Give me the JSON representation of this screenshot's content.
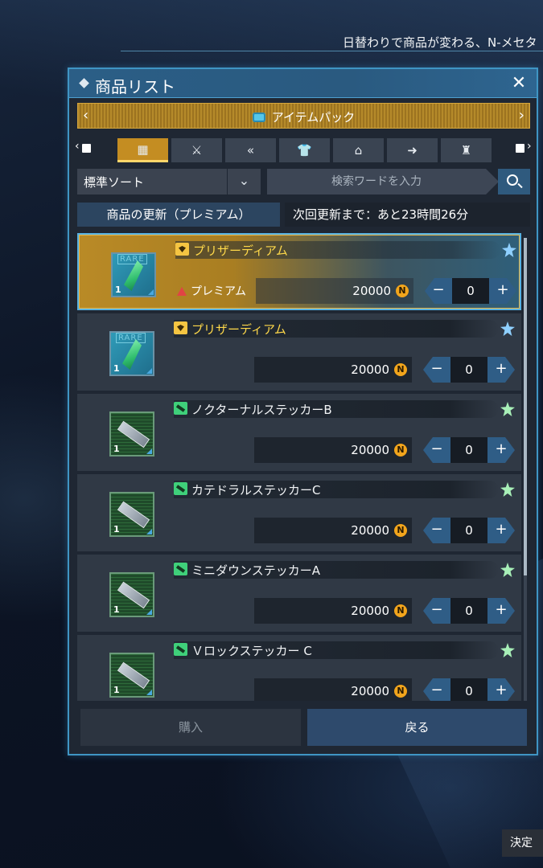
{
  "ticker": "日替わりで商品が変わる、N-メセタ",
  "window": {
    "title": "商品リスト",
    "close_symbol": "✕"
  },
  "category": {
    "label": "アイテムパック",
    "left_arrow": "‹",
    "right_arrow": "›"
  },
  "filter_tabs": [
    {
      "name": "all",
      "icon": "▦",
      "active": true
    },
    {
      "name": "weapon",
      "icon": "⚔",
      "active": false
    },
    {
      "name": "motion",
      "icon": "«",
      "active": false
    },
    {
      "name": "costume",
      "icon": "👕",
      "active": false
    },
    {
      "name": "tag",
      "icon": "⌂",
      "active": false
    },
    {
      "name": "arrow-sign",
      "icon": "➜",
      "active": false
    },
    {
      "name": "bag",
      "icon": "♜",
      "active": false
    }
  ],
  "sort": {
    "label": "標準ソート",
    "dropdown_symbol": "⌄"
  },
  "search": {
    "placeholder": "検索ワードを入力"
  },
  "refresh": {
    "label": "商品の更新（プレミアム）",
    "timer": "次回更新まで：あと23時間26分"
  },
  "items": [
    {
      "name": "プリザーディアム",
      "type": "gem",
      "name_color": "gold",
      "thumb": "rare",
      "thumb_tag": "RARE",
      "thumb_qty": "1",
      "premium": true,
      "premium_label": "プレミアム",
      "price": "20000",
      "currency_symbol": "N",
      "qty": "0",
      "selected": true,
      "minus": "−",
      "plus": "+"
    },
    {
      "name": "プリザーディアム",
      "type": "gem",
      "name_color": "gold",
      "thumb": "rare",
      "thumb_tag": "RARE",
      "thumb_qty": "1",
      "premium": false,
      "premium_label": "",
      "price": "20000",
      "currency_symbol": "N",
      "qty": "0",
      "selected": false,
      "minus": "−",
      "plus": "+"
    },
    {
      "name": "ノクターナルステッカーB",
      "type": "sticker",
      "name_color": "white",
      "thumb": "sticker",
      "thumb_tag": "",
      "thumb_qty": "1",
      "premium": false,
      "premium_label": "",
      "price": "20000",
      "currency_symbol": "N",
      "qty": "0",
      "selected": false,
      "minus": "−",
      "plus": "+"
    },
    {
      "name": "カテドラルステッカーC",
      "type": "sticker",
      "name_color": "white",
      "thumb": "sticker",
      "thumb_tag": "",
      "thumb_qty": "1",
      "premium": false,
      "premium_label": "",
      "price": "20000",
      "currency_symbol": "N",
      "qty": "0",
      "selected": false,
      "minus": "−",
      "plus": "+"
    },
    {
      "name": "ミニダウンステッカーA",
      "type": "sticker",
      "name_color": "white",
      "thumb": "sticker",
      "thumb_tag": "",
      "thumb_qty": "1",
      "premium": false,
      "premium_label": "",
      "price": "20000",
      "currency_symbol": "N",
      "qty": "0",
      "selected": false,
      "minus": "−",
      "plus": "+"
    },
    {
      "name": "Ｖロックステッカー C",
      "type": "sticker",
      "name_color": "white",
      "thumb": "sticker",
      "thumb_tag": "",
      "thumb_qty": "1",
      "premium": false,
      "premium_label": "",
      "price": "20000",
      "currency_symbol": "N",
      "qty": "0",
      "selected": false,
      "minus": "−",
      "plus": "+"
    }
  ],
  "scrollbar": {
    "position_fraction": 0.0
  },
  "buttons": {
    "buy": "購入",
    "back": "戻る"
  },
  "confirm_hint": "決定",
  "colors": {
    "accent_gold": "#c48d22",
    "accent_blue": "#3f95c4",
    "name_gold": "#ffd94a",
    "panel_bg": "#1f2733"
  }
}
